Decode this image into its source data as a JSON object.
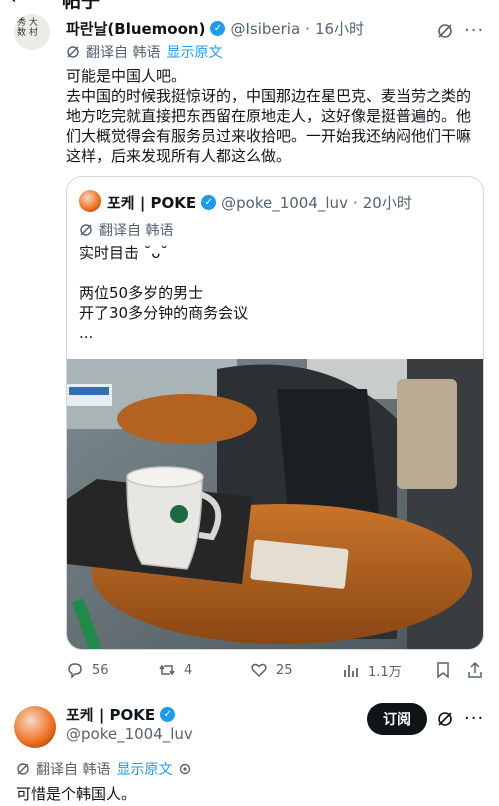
{
  "header": {
    "title": "帖子"
  },
  "tweet1": {
    "display_name": "파란날(Bluemoon)",
    "handle": "@Isiberia",
    "time": "16小时",
    "translate_label": "翻译自 韩语",
    "show_original": "显示原文",
    "text": "可能是中国人吧。\n去中国的时候我挺惊讶的，中国那边在星巴克、麦当劳之类的地方吃完就直接把东西留在原地走人，这好像是挺普遍的。他们大概觉得会有服务员过来收拾吧。一开始我还纳闷他们干嘛这样，后来发现所有人都这么做。",
    "avatar_text": "秀 大 数 村"
  },
  "quote": {
    "display_name": "포케 | POKE",
    "handle": "@poke_1004_luv",
    "time": "20小时",
    "translate_label": "翻译自 韩语",
    "text": "实时目击 ˘ᴗ˘\n\n两位50多岁的男士\n开了30多分钟的商务会议\n..."
  },
  "actions": {
    "replies": "56",
    "reposts": "4",
    "likes": "25",
    "views": "1.1万"
  },
  "reply": {
    "display_name": "포케 | POKE",
    "handle": "@poke_1004_luv",
    "subscribe_label": "订阅",
    "translate_label": "翻译自 韩语",
    "show_original": "显示原文",
    "text": "可惜是个韩国人。"
  },
  "colors": {
    "accent": "#1d9bf0",
    "text": "#0f1419",
    "muted": "#536471",
    "border": "#cfd9de"
  }
}
